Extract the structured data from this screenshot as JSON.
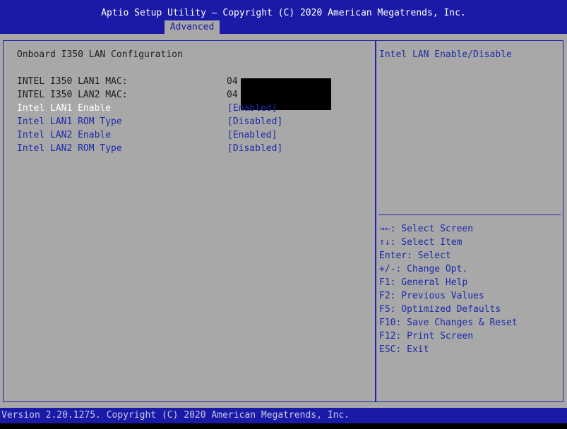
{
  "header": {
    "title": "Aptio Setup Utility – Copyright (C) 2020 American Megatrends, Inc.",
    "tab": "Advanced"
  },
  "left": {
    "section_title": "Onboard I350 LAN Configuration",
    "mac_rows": [
      {
        "label": "INTEL I350 LAN1 MAC:",
        "value": "04"
      },
      {
        "label": "INTEL I350 LAN2 MAC:",
        "value": "04"
      }
    ],
    "settings": [
      {
        "label": "Intel LAN1 Enable",
        "value": "[Enabled]"
      },
      {
        "label": "Intel LAN1 ROM Type",
        "value": "[Disabled]"
      },
      {
        "label": "Intel LAN2 Enable",
        "value": "[Enabled]"
      },
      {
        "label": "Intel LAN2 ROM Type",
        "value": "[Disabled]"
      }
    ]
  },
  "right": {
    "help_text": "Intel LAN Enable/Disable",
    "key_help": [
      "→←: Select Screen",
      "↑↓: Select Item",
      "Enter: Select",
      "+/-: Change Opt.",
      "F1: General Help",
      "F2: Previous Values",
      "F5: Optimized Defaults",
      "F10: Save Changes & Reset",
      "F12: Print Screen",
      "ESC: Exit"
    ]
  },
  "footer": {
    "text": "Version 2.20.1275. Copyright (C) 2020 American Megatrends, Inc."
  },
  "colors": {
    "header_bg": "#1a1aa6",
    "panel_bg": "#a8a8a8",
    "selected_text": "#ffffff",
    "option_text": "#1c2aa8",
    "static_text": "#1c1c1c"
  }
}
